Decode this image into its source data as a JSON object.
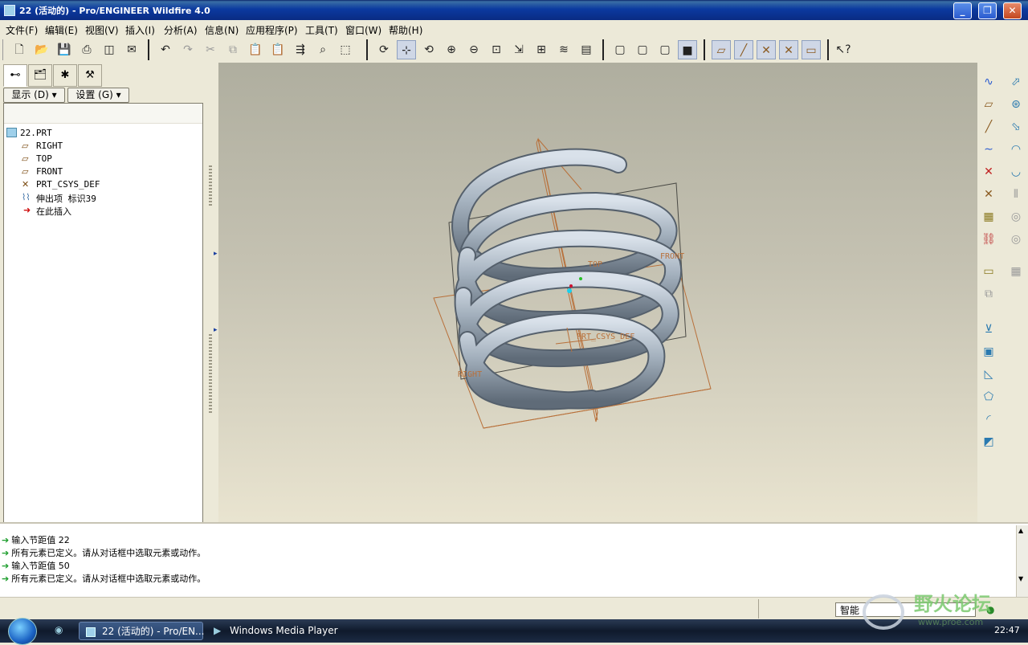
{
  "window": {
    "title": "22 (活动的) - Pro/ENGINEER Wildfire 4.0",
    "controls": [
      "_",
      "❐",
      "✕"
    ]
  },
  "menu": [
    "文件(F)",
    "编辑(E)",
    "视图(V)",
    "插入(I)",
    "分析(A)",
    "信息(N)",
    "应用程序(P)",
    "工具(T)",
    "窗口(W)",
    "帮助(H)"
  ],
  "toolbar": {
    "icons": [
      "new-file-icon",
      "open-folder-icon",
      "save-icon",
      "print-icon",
      "print-preview-icon",
      "mail-icon",
      "undo-icon",
      "redo-icon",
      "cut-icon",
      "copy-icon",
      "paste-icon",
      "paste-special-icon",
      "regenerate-icon",
      "find-icon",
      "select-box-icon",
      "repaint-icon",
      "spin-center-icon",
      "orient-mode-icon",
      "zoom-in-icon",
      "zoom-out-icon",
      "refit-icon",
      "reorient-icon",
      "saved-views-icon",
      "layers-icon",
      "view-manager-icon",
      "wireframe-icon",
      "hidden-line-icon",
      "no-hidden-icon",
      "shading-icon",
      "datum-planes-icon",
      "datum-axes-icon",
      "datum-points-icon",
      "coord-sys-icon",
      "annotations-icon",
      "context-help-icon"
    ]
  },
  "left_panel": {
    "display_button": "显示 (D) ▾",
    "settings_button": "设置 (G) ▾",
    "tree": [
      {
        "label": "22.PRT",
        "icon": "part-icon"
      },
      {
        "label": "RIGHT",
        "icon": "datum-plane-icon"
      },
      {
        "label": "TOP",
        "icon": "datum-plane-icon"
      },
      {
        "label": "FRONT",
        "icon": "datum-plane-icon"
      },
      {
        "label": "PRT_CSYS_DEF",
        "icon": "coord-sys-icon"
      },
      {
        "label": "伸出项 标识39",
        "icon": "protrusion-icon"
      },
      {
        "label": "在此插入",
        "icon": "insert-here-arrow-icon"
      }
    ]
  },
  "viewport": {
    "datum_labels": {
      "top": "TOP",
      "front": "FRONT",
      "right": "RIGHT",
      "csys": "PRT_CSYS_DEF"
    }
  },
  "messages": [
    "输入节距值  22",
    "所有元素已定义。请从对话框中选取元素或动作。",
    "输入节距值  50",
    "所有元素已定义。请从对话框中选取元素或动作。"
  ],
  "status": {
    "filter": "智能"
  },
  "taskbar": {
    "tasks": [
      "22 (活动的) - Pro/EN...",
      "Windows Media Player"
    ],
    "clock": "22:47"
  },
  "watermark": {
    "text": "野火论坛",
    "url": "www.proe.com"
  },
  "colors": {
    "titlebar": "#0b3aa0",
    "datum": "#b8703a",
    "spring": "#a3b0bd"
  }
}
